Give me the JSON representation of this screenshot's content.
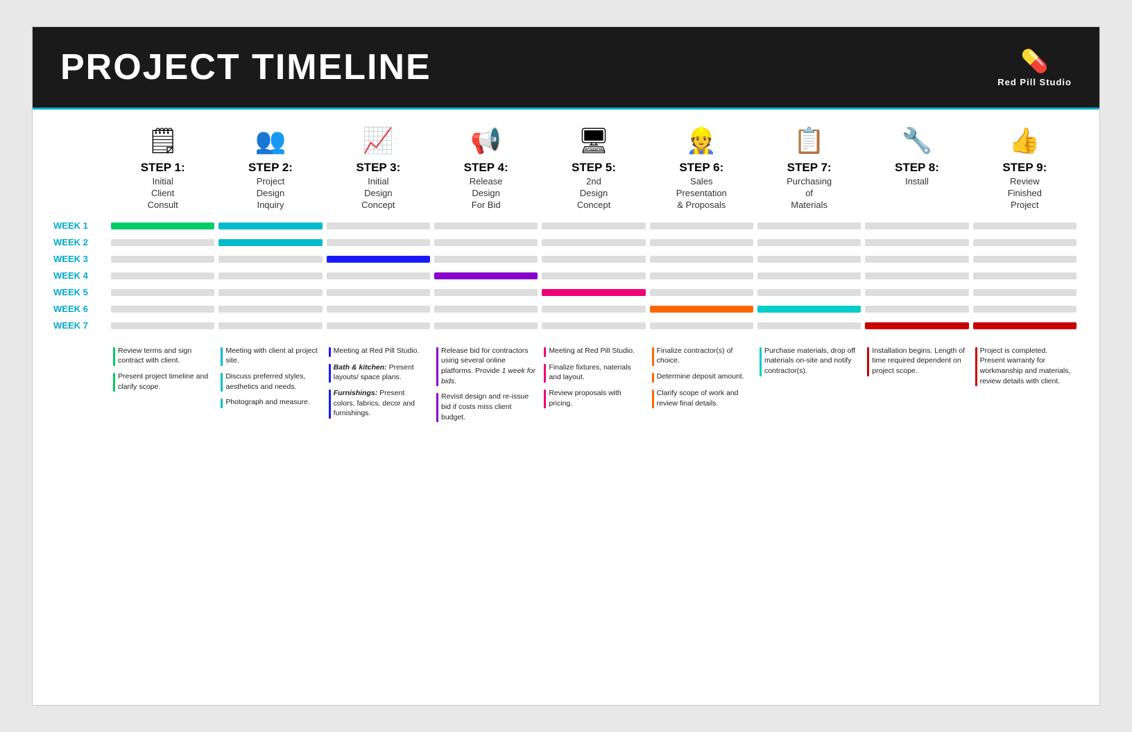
{
  "header": {
    "title": "PROJECT TIMELINE",
    "logo_icon": "💊",
    "logo_name": "Red Pill Studio"
  },
  "steps": [
    {
      "number": "STEP 1:",
      "icon": "🗒",
      "title": "Initial\nClient\nConsult"
    },
    {
      "number": "STEP 2:",
      "icon": "👥",
      "title": "Project\nDesign\nInquiry"
    },
    {
      "number": "STEP 3:",
      "icon": "📈",
      "title": "Initial\nDesign\nConcept"
    },
    {
      "number": "STEP 4:",
      "icon": "📢",
      "title": "Release\nDesign\nFor Bid"
    },
    {
      "number": "STEP 5:",
      "icon": "🖥",
      "title": "2nd\nDesign\nConcept"
    },
    {
      "number": "STEP 6:",
      "icon": "👷",
      "title": "Sales\nPresentation\n& Proposals"
    },
    {
      "number": "STEP 7:",
      "icon": "📋",
      "title": "Purchasing\nof\nMaterials"
    },
    {
      "number": "STEP 8:",
      "icon": "🔧",
      "title": "Install"
    },
    {
      "number": "STEP 9:",
      "icon": "👍",
      "title": "Review\nFinished\nProject"
    }
  ],
  "weeks": [
    "WEEK 1",
    "WEEK 2",
    "WEEK 3",
    "WEEK 4",
    "WEEK 5",
    "WEEK 6",
    "WEEK 7"
  ],
  "timeline": [
    [
      "active-green",
      "active-teal",
      "",
      "",
      "",
      "",
      "",
      "",
      ""
    ],
    [
      "",
      "active-teal",
      "",
      "",
      "",
      "",
      "",
      "",
      ""
    ],
    [
      "",
      "",
      "active-blue",
      "",
      "",
      "",
      "",
      "",
      ""
    ],
    [
      "",
      "",
      "",
      "active-purple",
      "",
      "",
      "",
      "",
      ""
    ],
    [
      "",
      "",
      "",
      "",
      "active-pink",
      "",
      "",
      "",
      ""
    ],
    [
      "",
      "",
      "",
      "",
      "",
      "active-orange",
      "active-cyan",
      "",
      ""
    ],
    [
      "",
      "",
      "",
      "",
      "",
      "",
      "",
      "active-red",
      "active-red"
    ]
  ],
  "notes": [
    {
      "items": [
        {
          "color": "#00cc66",
          "text": "Review terms and sign contract with client."
        },
        {
          "color": "#00cc66",
          "text": "Present project timeline and clarify scope."
        }
      ]
    },
    {
      "items": [
        {
          "color": "#00bbcc",
          "text": "Meeting with client at project site."
        },
        {
          "color": "#00bbcc",
          "text": "Discuss preferred styles, aesthetics and needs."
        },
        {
          "color": "#00bbcc",
          "text": "Photograph and measure."
        }
      ]
    },
    {
      "items": [
        {
          "color": "#1a1aff",
          "text": "Meeting at Red Pill Studio."
        },
        {
          "color": "#1a1aff",
          "text": "Bath & kitchen: Present layouts/ space plans."
        },
        {
          "color": "#1a1aff",
          "text": "Furnishings: Present colors, fabrics, decor and furnishings."
        }
      ]
    },
    {
      "items": [
        {
          "color": "#8800cc",
          "text": "Release bid for contractors using several online platforms. Provide 1 week for bids."
        },
        {
          "color": "#8800cc",
          "text": "Revisit design and re-issue bid if costs miss client budget."
        }
      ]
    },
    {
      "items": [
        {
          "color": "#ee0077",
          "text": "Meeting at Red Pill Studio."
        },
        {
          "color": "#ee0077",
          "text": "Finalize fixtures, naterials and layout."
        },
        {
          "color": "#ee0077",
          "text": "Review proposals with pricing."
        }
      ]
    },
    {
      "items": [
        {
          "color": "#ff6600",
          "text": "Finalize contractor(s) of choice."
        },
        {
          "color": "#ff6600",
          "text": "Determine deposit amount."
        },
        {
          "color": "#ff6600",
          "text": "Clarify scope of work and review final details."
        }
      ]
    },
    {
      "items": [
        {
          "color": "#00cccc",
          "text": "Purchase materials, drop off materials on-site and notify contractor(s)."
        }
      ]
    },
    {
      "items": [
        {
          "color": "#cc0000",
          "text": "Installation begins. Length of time required dependent on project scope."
        }
      ]
    },
    {
      "items": [
        {
          "color": "#cc0000",
          "text": "Project is completed. Present warranty for workmanship and materials, review details with client."
        }
      ]
    }
  ]
}
